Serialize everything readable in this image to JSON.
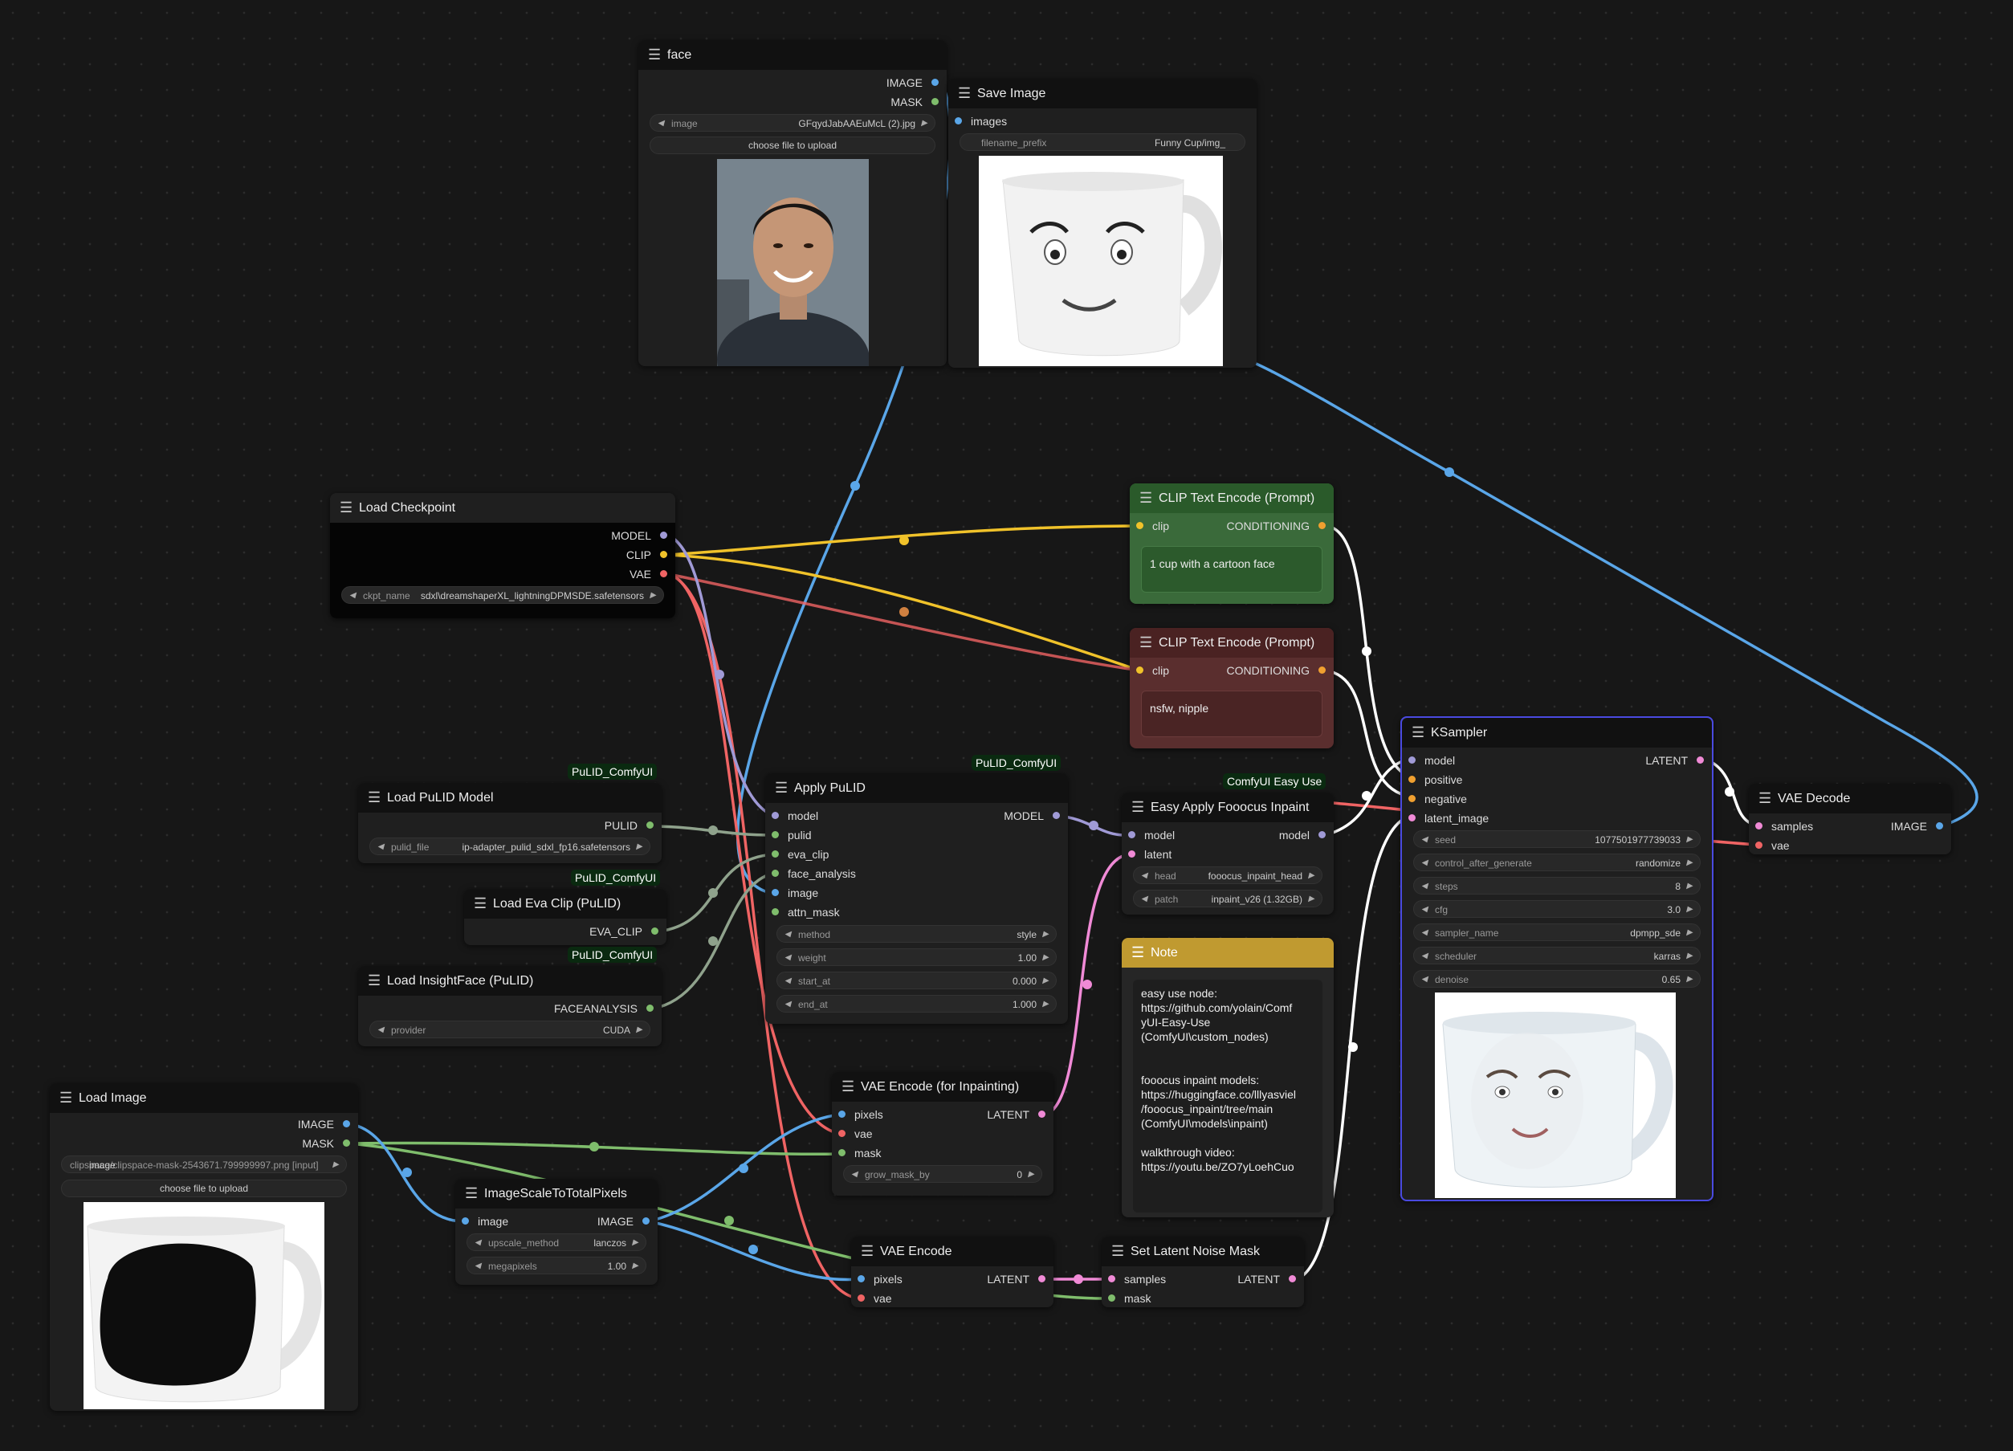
{
  "colors": {
    "image": "#5aa6e8",
    "mask": "#7fbd6c",
    "model": "#a09ad6",
    "clip": "#f0c22a",
    "vae": "#f06464",
    "latent": "#f08ad6",
    "conditioning": "#f0a030",
    "pulid": "#8fa28c",
    "accent": "#4a4ae0"
  },
  "nodes": {
    "face": {
      "title": "face",
      "out_image": "IMAGE",
      "out_mask": "MASK",
      "w_image_label": "image",
      "w_image_value": "GFqydJabAAEuMcL (2).jpg",
      "upload": "choose file to upload"
    },
    "save_image": {
      "title": "Save Image",
      "in_images": "images",
      "w_prefix_label": "filename_prefix",
      "w_prefix_value": "Funny Cup/img_"
    },
    "load_checkpoint": {
      "title": "Load Checkpoint",
      "out_model": "MODEL",
      "out_clip": "CLIP",
      "out_vae": "VAE",
      "w_ckpt_label": "ckpt_name",
      "w_ckpt_value": "sdxl\\dreamshaperXL_lightningDPMSDE.safetensors"
    },
    "clip_pos": {
      "title": "CLIP Text Encode (Prompt)",
      "in_clip": "clip",
      "out_cond": "CONDITIONING",
      "text": "1 cup with a cartoon face"
    },
    "clip_neg": {
      "title": "CLIP Text Encode (Prompt)",
      "in_clip": "clip",
      "out_cond": "CONDITIONING",
      "text": "nsfw, nipple"
    },
    "ksampler": {
      "title": "KSampler",
      "in_model": "model",
      "in_positive": "positive",
      "in_negative": "negative",
      "in_latent": "latent_image",
      "out_latent": "LATENT",
      "widgets": [
        {
          "label": "seed",
          "value": "1077501977739033"
        },
        {
          "label": "control_after_generate",
          "value": "randomize"
        },
        {
          "label": "steps",
          "value": "8"
        },
        {
          "label": "cfg",
          "value": "3.0"
        },
        {
          "label": "sampler_name",
          "value": "dpmpp_sde"
        },
        {
          "label": "scheduler",
          "value": "karras"
        },
        {
          "label": "denoise",
          "value": "0.65"
        }
      ]
    },
    "vae_decode": {
      "title": "VAE Decode",
      "in_samples": "samples",
      "in_vae": "vae",
      "out_image": "IMAGE"
    },
    "load_pulid": {
      "badge": "PuLID_ComfyUI",
      "title": "Load PuLID Model",
      "out_pulid": "PULID",
      "w_label": "pulid_file",
      "w_value": "ip-adapter_pulid_sdxl_fp16.safetensors"
    },
    "apply_pulid": {
      "badge": "PuLID_ComfyUI",
      "title": "Apply PuLID",
      "in_model": "model",
      "in_pulid": "pulid",
      "in_eva": "eva_clip",
      "in_face": "face_analysis",
      "in_image": "image",
      "in_attn": "attn_mask",
      "out_model": "MODEL",
      "widgets": [
        {
          "label": "method",
          "value": "style"
        },
        {
          "label": "weight",
          "value": "1.00"
        },
        {
          "label": "start_at",
          "value": "0.000"
        },
        {
          "label": "end_at",
          "value": "1.000"
        }
      ]
    },
    "eva_clip": {
      "badge": "PuLID_ComfyUI",
      "title": "Load Eva Clip (PuLID)",
      "out": "EVA_CLIP"
    },
    "insightface": {
      "badge": "PuLID_ComfyUI",
      "title": "Load InsightFace (PuLID)",
      "out": "FACEANALYSIS",
      "w_label": "provider",
      "w_value": "CUDA"
    },
    "fooocus": {
      "badge": "ComfyUI Easy Use",
      "title": "Easy Apply Fooocus Inpaint",
      "in_model": "model",
      "in_latent": "latent",
      "out_model": "model",
      "w_head_label": "head",
      "w_head_value": "fooocus_inpaint_head",
      "w_patch_label": "patch",
      "w_patch_value": "inpaint_v26 (1.32GB)"
    },
    "note": {
      "title": "Note",
      "text": "easy use node:\nhttps://github.com/yolain/Comf\nyUI-Easy-Use\n(ComfyUI\\custom_nodes)\n\n\nfooocus inpaint models:\nhttps://huggingface.co/lllyasviel\n/fooocus_inpaint/tree/main\n(ComfyUI\\models\\inpaint)\n\nwalkthrough video:\nhttps://youtu.be/ZO7yLoehCuo"
    },
    "load_image": {
      "title": "Load Image",
      "out_image": "IMAGE",
      "out_mask": "MASK",
      "w_value": "clipspace/clipspace-mask-2543671.799999997.png [input]",
      "w_label": "image",
      "upload": "choose file to upload"
    },
    "scale": {
      "title": "ImageScaleToTotalPixels",
      "in_image": "image",
      "out_image": "IMAGE",
      "w1_label": "upscale_method",
      "w1_value": "lanczos",
      "w2_label": "megapixels",
      "w2_value": "1.00"
    },
    "vae_enc_inpaint": {
      "title": "VAE Encode (for Inpainting)",
      "in_pixels": "pixels",
      "in_vae": "vae",
      "in_mask": "mask",
      "out_latent": "LATENT",
      "w_label": "grow_mask_by",
      "w_value": "0"
    },
    "vae_enc": {
      "title": "VAE Encode",
      "in_pixels": "pixels",
      "in_vae": "vae",
      "out_latent": "LATENT"
    },
    "noise_mask": {
      "title": "Set Latent Noise Mask",
      "in_samples": "samples",
      "in_mask": "mask",
      "out_latent": "LATENT"
    }
  }
}
